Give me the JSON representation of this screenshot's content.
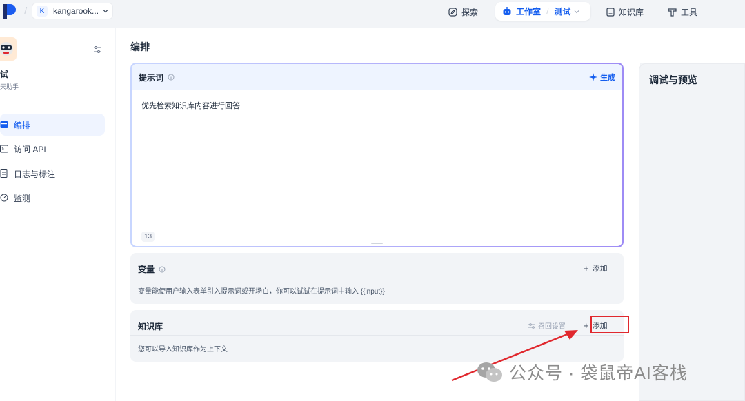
{
  "topbar": {
    "workspace_initial": "K",
    "workspace_name": "kangarook...",
    "nav": {
      "explore": "探索",
      "studio": "工作室",
      "studio_app": "测试",
      "knowledge": "知识库",
      "tools": "工具"
    }
  },
  "sidebar": {
    "app_name": "测试",
    "app_name_visible": "试",
    "app_type": "天助手",
    "items": [
      {
        "label": "编排",
        "icon": "layout-icon"
      },
      {
        "label": "访问 API",
        "icon": "terminal-icon"
      },
      {
        "label": "日志与标注",
        "icon": "log-icon"
      },
      {
        "label": "监测",
        "icon": "monitor-icon"
      }
    ]
  },
  "main": {
    "title": "编排",
    "prompt": {
      "label": "提示词",
      "generate_label": "生成",
      "text": "优先检索知识库内容进行回答",
      "char_count": "13"
    },
    "variables": {
      "label": "变量",
      "add_label": "添加",
      "description": "变量能使用户输入表单引入提示词或开场白，你可以试试在提示词中输入 {{input}}"
    },
    "knowledge": {
      "label": "知识库",
      "recall_label": "召回设置",
      "add_label": "添加",
      "description": "您可以导入知识库作为上下文"
    }
  },
  "preview": {
    "title": "调试与预览"
  },
  "watermark": {
    "text": "公众号 · 袋鼠帝AI客栈"
  },
  "colors": {
    "accent": "#155eef",
    "annotation_red": "#e0282e"
  }
}
